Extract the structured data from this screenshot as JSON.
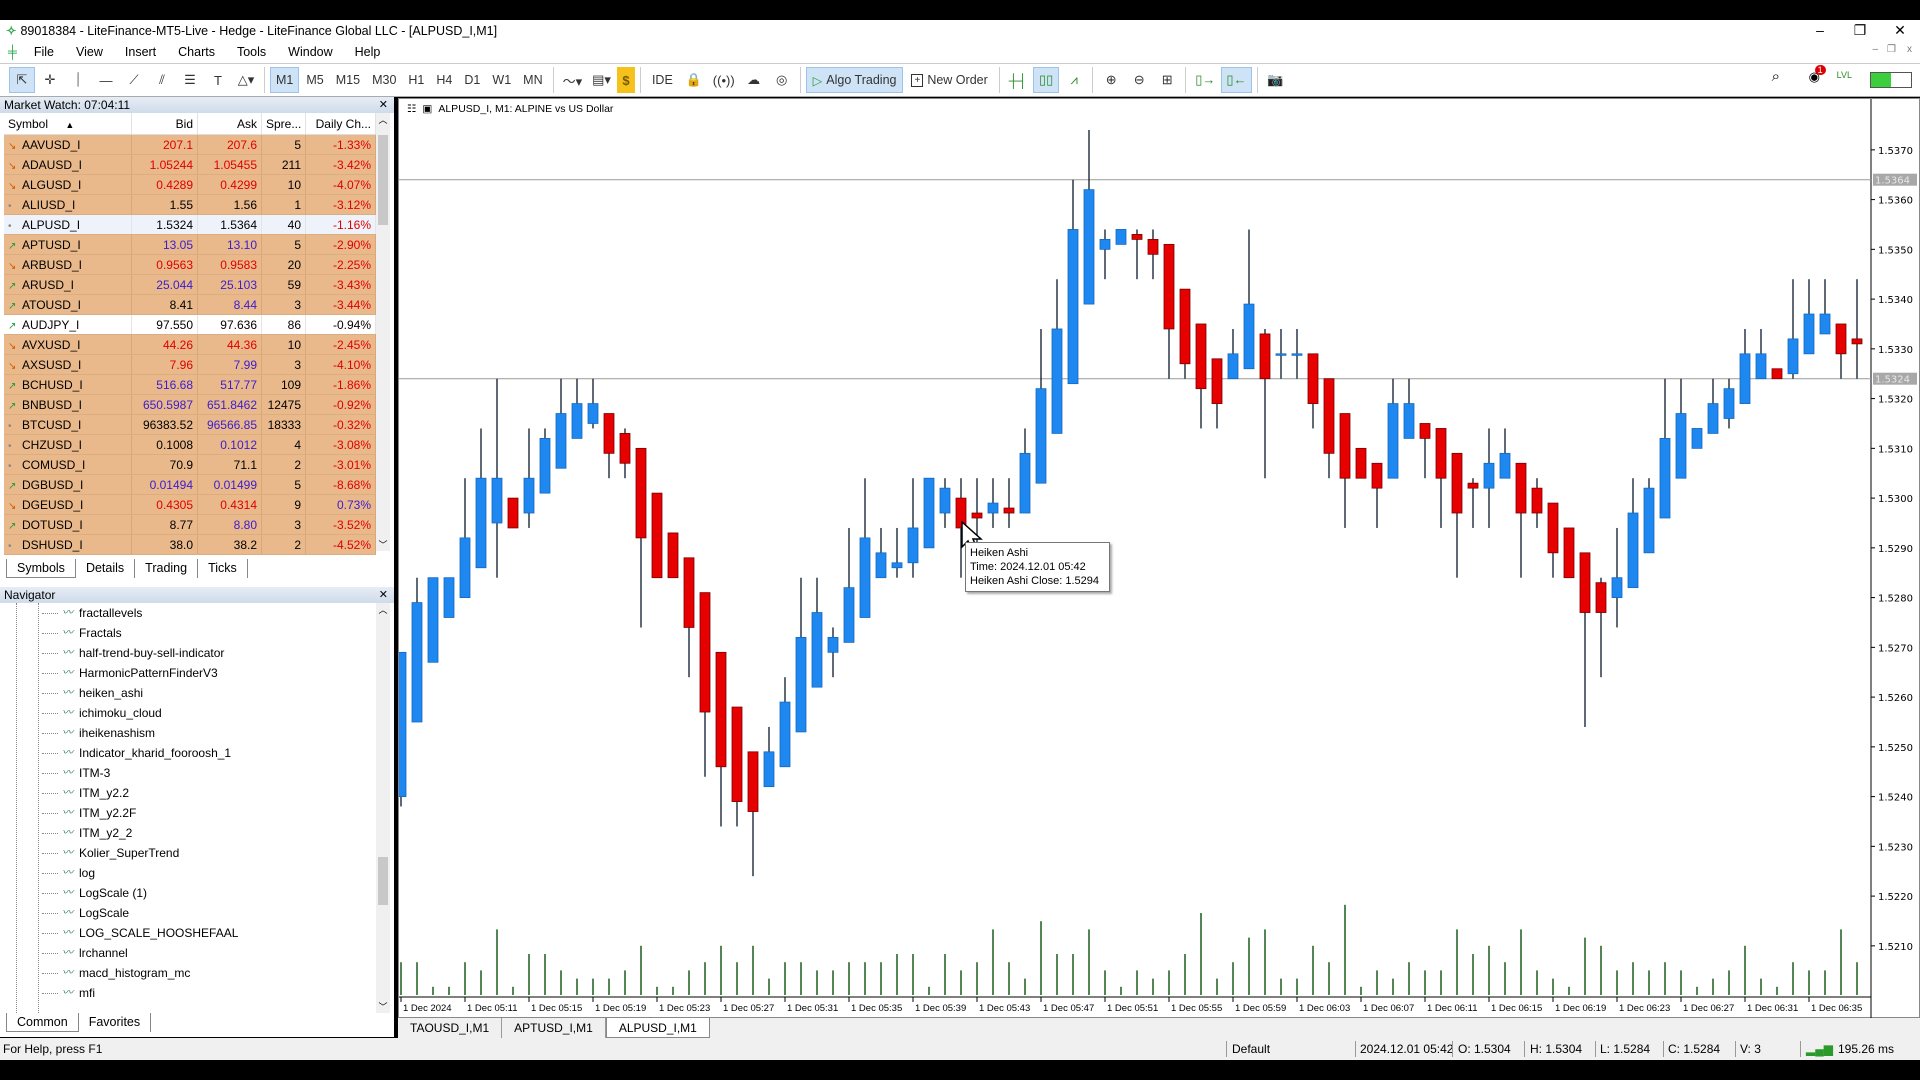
{
  "window": {
    "title": "89018384 - LiteFinance-MT5-Live - Hedge - LiteFinance Global LLC - [ALPUSD_I,M1]",
    "minimize": "–",
    "restore": "❐",
    "close": "✕"
  },
  "menu": [
    "File",
    "View",
    "Insert",
    "Charts",
    "Tools",
    "Window",
    "Help"
  ],
  "mdi_controls": [
    "–",
    "❐",
    "x"
  ],
  "toolbar": {
    "tools": [
      {
        "icon": "cursor-icon",
        "g": "⇱"
      },
      {
        "icon": "crosshair-icon",
        "g": "✛"
      },
      {
        "icon": "vertical-line-icon",
        "g": "⏐"
      },
      {
        "icon": "horizontal-line-icon",
        "g": "—"
      },
      {
        "icon": "trendline-icon",
        "g": "⟋"
      },
      {
        "icon": "channel-icon",
        "g": "⫽"
      },
      {
        "icon": "fibonacci-icon",
        "g": "☰"
      },
      {
        "icon": "text-icon",
        "g": "T"
      },
      {
        "icon": "shapes-icon",
        "g": "△▾"
      }
    ],
    "timeframes": [
      "M1",
      "M5",
      "M15",
      "M30",
      "H1",
      "H4",
      "D1",
      "W1",
      "MN"
    ],
    "active_timeframe": "M1",
    "ide": "IDE",
    "algo_trading": "Algo Trading",
    "new_order": "New Order",
    "badge": "1"
  },
  "market_watch": {
    "title": "Market Watch: 07:04:11",
    "columns": [
      "Symbol",
      "Bid",
      "Ask",
      "Spre...",
      "Daily Ch..."
    ],
    "rows": [
      {
        "trend": "down",
        "symbol": "AAVUSD_I",
        "bid": "207.1",
        "ask": "207.6",
        "spread": "5",
        "change": "-1.33%",
        "bc": "red",
        "ac": "red",
        "cc": "red",
        "bg": "orange"
      },
      {
        "trend": "down",
        "symbol": "ADAUSD_I",
        "bid": "1.05244",
        "ask": "1.05455",
        "spread": "211",
        "change": "-3.42%",
        "bc": "red",
        "ac": "red",
        "cc": "red",
        "bg": "orange"
      },
      {
        "trend": "down",
        "symbol": "ALGUSD_I",
        "bid": "0.4289",
        "ask": "0.4299",
        "spread": "10",
        "change": "-4.07%",
        "bc": "red",
        "ac": "red",
        "cc": "red",
        "bg": "orange"
      },
      {
        "trend": "flat",
        "symbol": "ALIUSD_I",
        "bid": "1.55",
        "ask": "1.56",
        "spread": "1",
        "change": "-3.12%",
        "bc": "blk",
        "ac": "blk",
        "cc": "red",
        "bg": "orange"
      },
      {
        "trend": "flat",
        "symbol": "ALPUSD_I",
        "bid": "1.5324",
        "ask": "1.5364",
        "spread": "40",
        "change": "-1.16%",
        "bc": "blk",
        "ac": "blk",
        "cc": "red",
        "bg": "sel"
      },
      {
        "trend": "up",
        "symbol": "APTUSD_I",
        "bid": "13.05",
        "ask": "13.10",
        "spread": "5",
        "change": "-2.90%",
        "bc": "blu",
        "ac": "blu",
        "cc": "red",
        "bg": "orange"
      },
      {
        "trend": "down",
        "symbol": "ARBUSD_I",
        "bid": "0.9563",
        "ask": "0.9583",
        "spread": "20",
        "change": "-2.25%",
        "bc": "red",
        "ac": "red",
        "cc": "red",
        "bg": "orange"
      },
      {
        "trend": "up",
        "symbol": "ARUSD_I",
        "bid": "25.044",
        "ask": "25.103",
        "spread": "59",
        "change": "-3.43%",
        "bc": "blu",
        "ac": "blu",
        "cc": "red",
        "bg": "orange"
      },
      {
        "trend": "up",
        "symbol": "ATOUSD_I",
        "bid": "8.41",
        "ask": "8.44",
        "spread": "3",
        "change": "-3.44%",
        "bc": "blk",
        "ac": "blu",
        "cc": "red",
        "bg": "orange"
      },
      {
        "trend": "up",
        "symbol": "AUDJPY_I",
        "bid": "97.550",
        "ask": "97.636",
        "spread": "86",
        "change": "-0.94%",
        "bc": "blk",
        "ac": "blk",
        "cc": "blk",
        "bg": "white"
      },
      {
        "trend": "down",
        "symbol": "AVXUSD_I",
        "bid": "44.26",
        "ask": "44.36",
        "spread": "10",
        "change": "-2.45%",
        "bc": "red",
        "ac": "red",
        "cc": "red",
        "bg": "orange"
      },
      {
        "trend": "down",
        "symbol": "AXSUSD_I",
        "bid": "7.96",
        "ask": "7.99",
        "spread": "3",
        "change": "-4.10%",
        "bc": "red",
        "ac": "blu",
        "cc": "red",
        "bg": "orange"
      },
      {
        "trend": "up",
        "symbol": "BCHUSD_I",
        "bid": "516.68",
        "ask": "517.77",
        "spread": "109",
        "change": "-1.86%",
        "bc": "blu",
        "ac": "blu",
        "cc": "red",
        "bg": "orange"
      },
      {
        "trend": "up",
        "symbol": "BNBUSD_I",
        "bid": "650.5987",
        "ask": "651.8462",
        "spread": "12475",
        "change": "-0.92%",
        "bc": "blu",
        "ac": "blu",
        "cc": "red",
        "bg": "orange"
      },
      {
        "trend": "flat",
        "symbol": "BTCUSD_I",
        "bid": "96383.52",
        "ask": "96566.85",
        "spread": "18333",
        "change": "-0.32%",
        "bc": "blk",
        "ac": "blu",
        "cc": "red",
        "bg": "orange"
      },
      {
        "trend": "flat",
        "symbol": "CHZUSD_I",
        "bid": "0.1008",
        "ask": "0.1012",
        "spread": "4",
        "change": "-3.08%",
        "bc": "blk",
        "ac": "blu",
        "cc": "red",
        "bg": "orange"
      },
      {
        "trend": "flat",
        "symbol": "COMUSD_I",
        "bid": "70.9",
        "ask": "71.1",
        "spread": "2",
        "change": "-3.01%",
        "bc": "blk",
        "ac": "blk",
        "cc": "red",
        "bg": "orange"
      },
      {
        "trend": "up",
        "symbol": "DGBUSD_I",
        "bid": "0.01494",
        "ask": "0.01499",
        "spread": "5",
        "change": "-8.68%",
        "bc": "blu",
        "ac": "blu",
        "cc": "red",
        "bg": "orange"
      },
      {
        "trend": "down",
        "symbol": "DGEUSD_I",
        "bid": "0.4305",
        "ask": "0.4314",
        "spread": "9",
        "change": "0.73%",
        "bc": "red",
        "ac": "red",
        "cc": "blu",
        "bg": "orange"
      },
      {
        "trend": "up",
        "symbol": "DOTUSD_I",
        "bid": "8.77",
        "ask": "8.80",
        "spread": "3",
        "change": "-3.52%",
        "bc": "blk",
        "ac": "blu",
        "cc": "red",
        "bg": "orange"
      },
      {
        "trend": "flat",
        "symbol": "DSHUSD_I",
        "bid": "38.0",
        "ask": "38.2",
        "spread": "2",
        "change": "-4.52%",
        "bc": "blk",
        "ac": "blk",
        "cc": "red",
        "bg": "orange"
      }
    ],
    "tabs": [
      "Symbols",
      "Details",
      "Trading",
      "Ticks"
    ],
    "active_tab": "Symbols"
  },
  "navigator": {
    "title": "Navigator",
    "items": [
      "fractallevels",
      "Fractals",
      "half-trend-buy-sell-indicator",
      "HarmonicPatternFinderV3",
      "heiken_ashi",
      "ichimoku_cloud",
      "iheikenashism",
      "Indicator_kharid_fooroosh_1",
      "ITM-3",
      "ITM_y2.2",
      "ITM_y2.2F",
      "ITM_y2_2",
      "Kolier_SuperTrend",
      "log",
      "LogScale (1)",
      "LogScale",
      "LOG_SCALE_HOOSHEFAAL",
      "lrchannel",
      "macd_histogram_mc",
      "mfi"
    ],
    "tabs": [
      "Common",
      "Favorites"
    ],
    "active_tab": "Common"
  },
  "chart": {
    "title": "ALPUSD_I, M1:  ALPINE vs US Dollar",
    "tooltip": {
      "line1": "Heiken Ashi",
      "line2": "Time: 2024.12.01 05:42",
      "line3": "Heiken Ashi Close: 1.5294"
    },
    "tabs": [
      "TAOUSD_I,M1",
      "APTUSD_I,M1",
      "ALPUSD_I,M1"
    ],
    "active_tab": "ALPUSD_I,M1"
  },
  "chart_data": {
    "type": "candlestick",
    "series_name": "Heiken Ashi",
    "timeframe": "M1",
    "start_time": "05:07",
    "bull_color": "#1e88f0",
    "bear_color": "#e60000",
    "volume_color": "#1a5c1a",
    "bid_line": 1.5324,
    "ask_line": 1.5364,
    "bid_label": "1.5324",
    "ask_label": "1.5364",
    "ylim": [
      1.5202,
      1.5379
    ],
    "yticks": [
      "1.5370",
      "1.5360",
      "1.5350",
      "1.5340",
      "1.5330",
      "1.5320",
      "1.5310",
      "1.5300",
      "1.5290",
      "1.5280",
      "1.5270",
      "1.5260",
      "1.5250",
      "1.5240",
      "1.5230",
      "1.5220",
      "1.5210"
    ],
    "xticks": [
      "1 Dec 2024",
      "1 Dec 05:11",
      "1 Dec 05:15",
      "1 Dec 05:19",
      "1 Dec 05:23",
      "1 Dec 05:27",
      "1 Dec 05:31",
      "1 Dec 05:35",
      "1 Dec 05:39",
      "1 Dec 05:43",
      "1 Dec 05:47",
      "1 Dec 05:51",
      "1 Dec 05:55",
      "1 Dec 05:59",
      "1 Dec 06:03",
      "1 Dec 06:07",
      "1 Dec 06:11",
      "1 Dec 06:15",
      "1 Dec 06:19",
      "1 Dec 06:23",
      "1 Dec 06:27",
      "1 Dec 06:31",
      "1 Dec 06:35"
    ],
    "ohlc": [
      [
        1.524,
        1.5269,
        1.5238,
        1.5269
      ],
      [
        1.5255,
        1.5284,
        1.5255,
        1.5279
      ],
      [
        1.5267,
        1.5284,
        1.5267,
        1.5284
      ],
      [
        1.5276,
        1.5284,
        1.5276,
        1.5284
      ],
      [
        1.528,
        1.5304,
        1.528,
        1.5292
      ],
      [
        1.5286,
        1.5314,
        1.5286,
        1.5304
      ],
      [
        1.5295,
        1.5324,
        1.5284,
        1.5304
      ],
      [
        1.53,
        1.53,
        1.5294,
        1.5294
      ],
      [
        1.5297,
        1.5314,
        1.5294,
        1.5304
      ],
      [
        1.5301,
        1.5314,
        1.5301,
        1.5312
      ],
      [
        1.5306,
        1.5324,
        1.5306,
        1.5317
      ],
      [
        1.5312,
        1.5324,
        1.5312,
        1.5319
      ],
      [
        1.5315,
        1.5324,
        1.5314,
        1.5319
      ],
      [
        1.5317,
        1.5317,
        1.5304,
        1.5309
      ],
      [
        1.5313,
        1.5314,
        1.5304,
        1.5307
      ],
      [
        1.531,
        1.531,
        1.5274,
        1.5292
      ],
      [
        1.5301,
        1.5301,
        1.5284,
        1.5284
      ],
      [
        1.5293,
        1.5293,
        1.5284,
        1.5284
      ],
      [
        1.5288,
        1.5288,
        1.5264,
        1.5274
      ],
      [
        1.5281,
        1.5281,
        1.5244,
        1.5257
      ],
      [
        1.5269,
        1.5269,
        1.5234,
        1.5246
      ],
      [
        1.5258,
        1.5258,
        1.5234,
        1.5239
      ],
      [
        1.5249,
        1.5249,
        1.5224,
        1.5237
      ],
      [
        1.5242,
        1.5254,
        1.5242,
        1.5249
      ],
      [
        1.5246,
        1.5264,
        1.5246,
        1.5259
      ],
      [
        1.5253,
        1.5284,
        1.5253,
        1.5272
      ],
      [
        1.5262,
        1.5284,
        1.5262,
        1.5277
      ],
      [
        1.5269,
        1.5274,
        1.5264,
        1.5272
      ],
      [
        1.5271,
        1.5294,
        1.5271,
        1.5282
      ],
      [
        1.5276,
        1.5304,
        1.5276,
        1.5292
      ],
      [
        1.5284,
        1.5294,
        1.5284,
        1.5289
      ],
      [
        1.5286,
        1.5294,
        1.5284,
        1.5287
      ],
      [
        1.5287,
        1.5304,
        1.5284,
        1.5294
      ],
      [
        1.529,
        1.5304,
        1.529,
        1.5304
      ],
      [
        1.5297,
        1.5304,
        1.5294,
        1.5302
      ],
      [
        1.53,
        1.5304,
        1.5284,
        1.5294
      ],
      [
        1.5297,
        1.5304,
        1.5284,
        1.5296
      ],
      [
        1.5297,
        1.5304,
        1.5294,
        1.5299
      ],
      [
        1.5298,
        1.5304,
        1.5294,
        1.5297
      ],
      [
        1.5297,
        1.5314,
        1.5297,
        1.5309
      ],
      [
        1.5303,
        1.5334,
        1.5303,
        1.5322
      ],
      [
        1.5313,
        1.5344,
        1.5313,
        1.5334
      ],
      [
        1.5323,
        1.5364,
        1.5323,
        1.5354
      ],
      [
        1.5339,
        1.5374,
        1.5339,
        1.5362
      ],
      [
        1.535,
        1.5354,
        1.5344,
        1.5352
      ],
      [
        1.5351,
        1.5354,
        1.5351,
        1.5354
      ],
      [
        1.5353,
        1.5354,
        1.5344,
        1.5352
      ],
      [
        1.5352,
        1.5354,
        1.5344,
        1.5349
      ],
      [
        1.5351,
        1.5351,
        1.5324,
        1.5334
      ],
      [
        1.5342,
        1.5342,
        1.5324,
        1.5327
      ],
      [
        1.5335,
        1.5335,
        1.5314,
        1.5322
      ],
      [
        1.5328,
        1.5328,
        1.5314,
        1.5319
      ],
      [
        1.5324,
        1.5334,
        1.5324,
        1.5329
      ],
      [
        1.5326,
        1.5354,
        1.5326,
        1.5339
      ],
      [
        1.5333,
        1.5334,
        1.5304,
        1.5324
      ],
      [
        1.5329,
        1.5334,
        1.5324,
        1.5329
      ],
      [
        1.5329,
        1.5334,
        1.5324,
        1.5329
      ],
      [
        1.5329,
        1.5329,
        1.5314,
        1.5319
      ],
      [
        1.5324,
        1.5324,
        1.5304,
        1.5309
      ],
      [
        1.5317,
        1.5317,
        1.5294,
        1.5304
      ],
      [
        1.531,
        1.531,
        1.5304,
        1.5304
      ],
      [
        1.5307,
        1.5307,
        1.5294,
        1.5302
      ],
      [
        1.5304,
        1.5324,
        1.5304,
        1.5319
      ],
      [
        1.5312,
        1.5324,
        1.5312,
        1.5319
      ],
      [
        1.5315,
        1.5315,
        1.5304,
        1.5312
      ],
      [
        1.5314,
        1.5314,
        1.5294,
        1.5304
      ],
      [
        1.5309,
        1.5309,
        1.5284,
        1.5297
      ],
      [
        1.5303,
        1.5304,
        1.5294,
        1.5302
      ],
      [
        1.5302,
        1.5314,
        1.5294,
        1.5307
      ],
      [
        1.5304,
        1.5314,
        1.5304,
        1.5309
      ],
      [
        1.5307,
        1.5307,
        1.5284,
        1.5297
      ],
      [
        1.5302,
        1.5304,
        1.5294,
        1.5297
      ],
      [
        1.5299,
        1.5299,
        1.5284,
        1.5289
      ],
      [
        1.5294,
        1.5294,
        1.5284,
        1.5284
      ],
      [
        1.5289,
        1.5289,
        1.5254,
        1.5277
      ],
      [
        1.5283,
        1.5284,
        1.5264,
        1.5277
      ],
      [
        1.528,
        1.5294,
        1.5274,
        1.5284
      ],
      [
        1.5282,
        1.5304,
        1.5282,
        1.5297
      ],
      [
        1.5289,
        1.5304,
        1.5289,
        1.5302
      ],
      [
        1.5296,
        1.5324,
        1.5296,
        1.5312
      ],
      [
        1.5304,
        1.5324,
        1.5304,
        1.5317
      ],
      [
        1.531,
        1.5314,
        1.531,
        1.5314
      ],
      [
        1.5313,
        1.5324,
        1.5313,
        1.5319
      ],
      [
        1.5316,
        1.5324,
        1.5314,
        1.5322
      ],
      [
        1.5319,
        1.5334,
        1.5319,
        1.5329
      ],
      [
        1.5324,
        1.5334,
        1.5324,
        1.5329
      ],
      [
        1.5326,
        1.5326,
        1.5324,
        1.5324
      ],
      [
        1.5325,
        1.5344,
        1.5324,
        1.5332
      ],
      [
        1.5329,
        1.5344,
        1.5329,
        1.5337
      ],
      [
        1.5333,
        1.5344,
        1.5333,
        1.5337
      ],
      [
        1.5335,
        1.5335,
        1.5324,
        1.5329
      ],
      [
        1.5332,
        1.5344,
        1.5324,
        1.5331
      ]
    ],
    "volume": [
      4,
      4,
      1,
      1,
      4,
      3,
      8,
      1,
      5,
      5,
      3,
      2,
      2,
      2,
      3,
      6,
      1,
      1,
      3,
      4,
      6,
      4,
      6,
      2,
      4,
      4,
      3,
      3,
      4,
      4,
      4,
      5,
      5,
      1,
      5,
      3,
      4,
      8,
      4,
      2,
      9,
      5,
      5,
      8,
      3,
      1,
      3,
      2,
      3,
      5,
      10,
      2,
      4,
      7,
      8,
      2,
      2,
      6,
      4,
      11,
      1,
      3,
      2,
      4,
      3,
      3,
      8,
      5,
      6,
      4,
      8,
      3,
      2,
      1,
      7,
      6,
      3,
      4,
      3,
      4,
      3,
      1,
      2,
      3,
      6,
      2,
      1,
      4,
      3,
      3,
      8,
      4
    ]
  },
  "status": {
    "help": "For Help, press F1",
    "profile": "Default",
    "time": "2024.12.01 05:42",
    "open": "O: 1.5304",
    "high": "H: 1.5304",
    "low": "L: 1.5284",
    "close": "C: 1.5284",
    "volume": "V: 3",
    "ping": "195.26 ms"
  }
}
